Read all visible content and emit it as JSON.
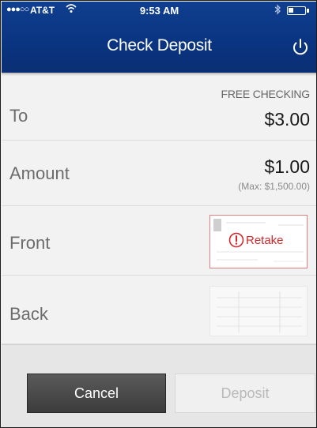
{
  "status_bar": {
    "signal": "●●●○○",
    "carrier": "AT&T",
    "time": "9:53 AM"
  },
  "header": {
    "title": "Check Deposit"
  },
  "rows": {
    "to": {
      "label": "To",
      "account": "FREE CHECKING",
      "value": "$3.00"
    },
    "amount": {
      "label": "Amount",
      "value": "$1.00",
      "max": "(Max: $1,500.00)"
    },
    "front": {
      "label": "Front",
      "status_label": "Retake"
    },
    "back": {
      "label": "Back"
    }
  },
  "footer": {
    "cancel_label": "Cancel",
    "deposit_label": "Deposit"
  },
  "colors": {
    "header_blue": "#0a3480",
    "retake_red": "#d6262b"
  },
  "icons": [
    "wifi-icon",
    "bluetooth-icon",
    "battery-icon",
    "power-icon",
    "alert-icon"
  ]
}
